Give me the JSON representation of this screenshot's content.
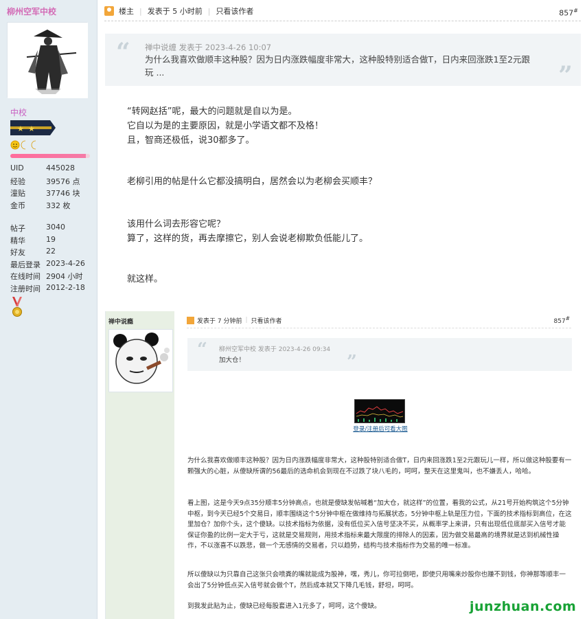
{
  "sidebar": {
    "username": "柳州空军中校",
    "rank": "中校",
    "stats_top": [
      {
        "label": "UID",
        "value": "445028"
      },
      {
        "label": "经验",
        "value": "39576 点"
      },
      {
        "label": "潼贴",
        "value": "37746 块"
      },
      {
        "label": "金币",
        "value": "332 枚"
      }
    ],
    "stats_bottom": [
      {
        "label": "帖子",
        "value": "3040"
      },
      {
        "label": "精华",
        "value": "19"
      },
      {
        "label": "好友",
        "value": "22"
      },
      {
        "label": "最后登录",
        "value": "2023-4-26"
      },
      {
        "label": "在线时间",
        "value": "2904 小时"
      },
      {
        "label": "注册时间",
        "value": "2012-2-18"
      }
    ],
    "progress": 0.95
  },
  "post": {
    "owner_label": "楼主",
    "posted": "发表于 5 小时前",
    "only_author": "只看该作者",
    "floor": "857",
    "floor_mark": "#"
  },
  "quote": {
    "meta": "禅中说缠 发表于 2023-4-26 10:07",
    "text": "为什么我喜欢做顺丰这种股？因为日内涨跌幅度非常大，这种股特别适合做T，日内来回涨跌1至2元跟玩 ..."
  },
  "body": {
    "p1": [
      "“转网赵括”呢，最大的问题就是自以为是。",
      "它自以为是的主要原因，就是小学语文都不及格！",
      "且，智商还极低，说30都多了。"
    ],
    "p2": [
      "老柳引用的帖是什么它都没搞明白，居然会以为老柳会买顺丰？"
    ],
    "p3": [
      "该用什么词去形容它呢？",
      "算了，这样的货，再去摩擦它，别人会说老柳欺负低能儿了。"
    ],
    "p4": [
      "就这样。"
    ]
  },
  "embed": {
    "username": "禅中说瘾",
    "posted": "发表于 7 分钟前",
    "only_author": "只看该作者",
    "floor": "857",
    "floor_mark": "#",
    "quote_meta": "柳州空军中校 发表于 2023-4-26 09:34",
    "quote_text": "加大仓！",
    "thumb_link": "登录/注册后可看大图",
    "para1": "为什么我喜欢做顺丰这种股？因为日内涨跌幅度非常大，这种股特别适合做T，日内来回涨跌1至2元跟玩儿一样，所以做这种股要有一颗强大的心脏，从傻缺所谓的56最后的选命机会到现在不过跌了块八毛的，呵呵，整天在这里鬼叫，也不嫌丢人，哈哈。",
    "para2": "看上图，这是今天9点35分顺丰5分钟高点，也就是傻缺发帖喊着“加大仓，就这样”的位置，看我的公式，从21号开始构筑这个5分钟中枢，到今天已经5个交易日，顺丰围绕这个5分钟中枢在做维持与拓展状态，5分钟中枢上轨是压力位，下面的技术指标到高位，在这里加仓？加你个头，这个傻缺。以技术指标为依据，没有低位买入信号坚决不买，从概率学上来讲，只有出现低位底部买入信号才能保证你盈的比例一定大于亏，这就是交易规则，用技术指标来最大限度的排除人的因素，因为做交易最高的境界就是达到机械性操作，不以涨喜不以跌悲，做一个无感情的交易者，只以趋势，结构与技术指标作为交易的唯一标准。",
    "para3": "所以傻缺以为只靠自己这张只会喷粪的嘴就能成为股神，嘿，秀儿，你可拉倒吧，即使只用嘴来炒股你也赚不到钱，你神那等顺丰一会出了5分钟低点买入信号就会做个T，然后成本就又下降几毛钱，舒坦，呵呵。",
    "para4": "到我发此贴为止，傻缺已经每股套进入1元多了，呵呵，这个傻缺。"
  },
  "watermark": "junzhuan.com"
}
